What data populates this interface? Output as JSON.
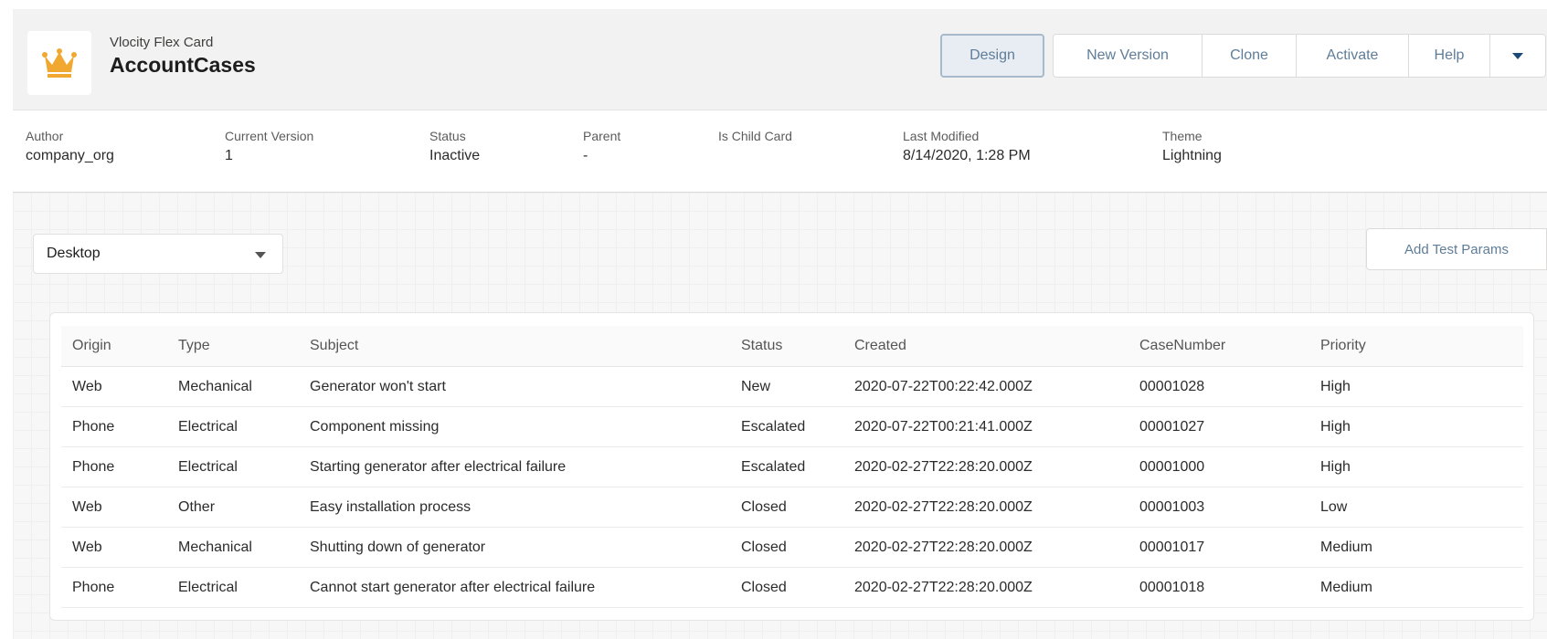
{
  "header": {
    "subtitle": "Vlocity Flex Card",
    "title": "AccountCases",
    "buttons": {
      "design": "Design",
      "new_version": "New Version",
      "clone": "Clone",
      "activate": "Activate",
      "help": "Help"
    },
    "logo_icon": "crown-icon",
    "colors": {
      "logo": "#f0a830",
      "button_text": "#5f7d99"
    }
  },
  "info": {
    "author_label": "Author",
    "author_value": "company_org",
    "version_label": "Current Version",
    "version_value": "1",
    "status_label": "Status",
    "status_value": "Inactive",
    "parent_label": "Parent",
    "parent_value": "-",
    "child_label": "Is Child Card",
    "modified_label": "Last Modified",
    "modified_value": "8/14/2020, 1:28 PM",
    "theme_label": "Theme",
    "theme_value": "Lightning"
  },
  "toolbar": {
    "device": "Desktop",
    "add_test_params": "Add Test Params"
  },
  "table": {
    "columns": [
      "Origin",
      "Type",
      "Subject",
      "Status",
      "Created",
      "CaseNumber",
      "Priority"
    ],
    "rows": [
      [
        "Web",
        "Mechanical",
        "Generator won't start",
        "New",
        "2020-07-22T00:22:42.000Z",
        "00001028",
        "High"
      ],
      [
        "Phone",
        "Electrical",
        "Component missing",
        "Escalated",
        "2020-07-22T00:21:41.000Z",
        "00001027",
        "High"
      ],
      [
        "Phone",
        "Electrical",
        "Starting generator after electrical failure",
        "Escalated",
        "2020-02-27T22:28:20.000Z",
        "00001000",
        "High"
      ],
      [
        "Web",
        "Other",
        "Easy installation process",
        "Closed",
        "2020-02-27T22:28:20.000Z",
        "00001003",
        "Low"
      ],
      [
        "Web",
        "Mechanical",
        "Shutting down of generator",
        "Closed",
        "2020-02-27T22:28:20.000Z",
        "00001017",
        "Medium"
      ],
      [
        "Phone",
        "Electrical",
        "Cannot start generator after electrical failure",
        "Closed",
        "2020-02-27T22:28:20.000Z",
        "00001018",
        "Medium"
      ]
    ]
  }
}
